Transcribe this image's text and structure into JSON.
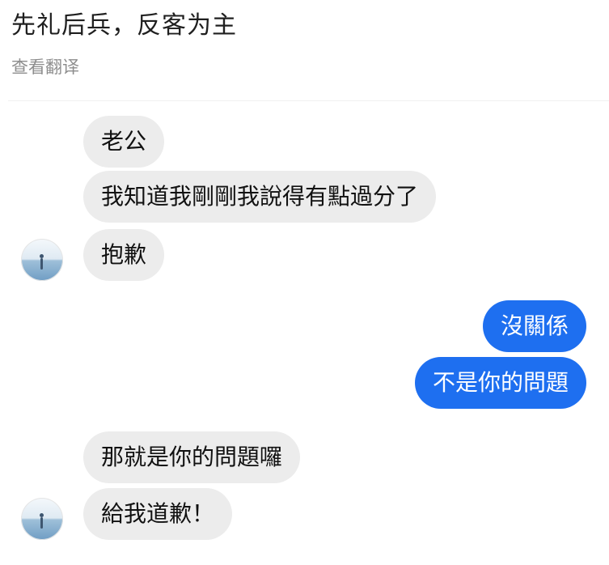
{
  "post": {
    "title": "先礼后兵，反客为主",
    "translate_label": "查看翻译"
  },
  "chat": {
    "messages": [
      {
        "sender": "other",
        "text": "老公"
      },
      {
        "sender": "other",
        "text": "我知道我剛剛我說得有點過分了"
      },
      {
        "sender": "other",
        "text": "抱歉"
      },
      {
        "sender": "me",
        "text": "沒關係"
      },
      {
        "sender": "me",
        "text": "不是你的問題"
      },
      {
        "sender": "other",
        "text": "那就是你的問題囉"
      },
      {
        "sender": "other",
        "text": "給我道歉！"
      }
    ]
  },
  "colors": {
    "incoming_bubble": "#ececec",
    "outgoing_bubble": "#1e6ff0",
    "translate_link": "#8d8d8d"
  }
}
